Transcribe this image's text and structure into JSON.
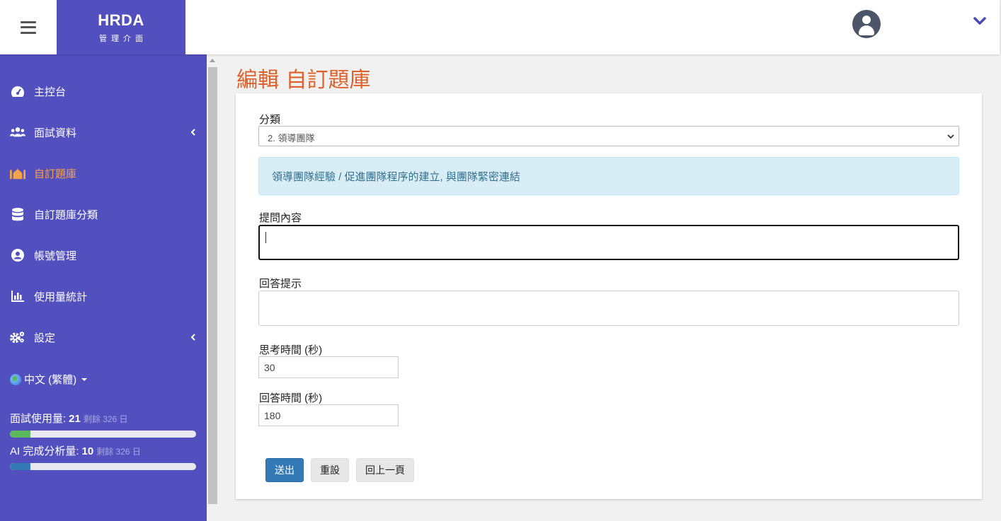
{
  "brand": {
    "name": "HRDA",
    "subtitle": "管理介面"
  },
  "page": {
    "title": "編輯 自訂題庫"
  },
  "sidebar": {
    "items": [
      {
        "label": "主控台",
        "icon": "tachometer-icon"
      },
      {
        "label": "面試資料",
        "icon": "users-icon"
      },
      {
        "label": "自訂題庫",
        "icon": "mosque-icon",
        "active": true
      },
      {
        "label": "自訂題庫分類",
        "icon": "database-icon"
      },
      {
        "label": "帳號管理",
        "icon": "user-circle-icon"
      },
      {
        "label": "使用量統計",
        "icon": "bar-chart-icon"
      },
      {
        "label": "設定",
        "icon": "gears-icon"
      }
    ],
    "language": "中文 (繁體)",
    "usage": {
      "interview": {
        "label": "面試使用量:",
        "count": "21",
        "remaining": "剩餘 326 日",
        "fill_fraction": 0.11,
        "color": "#5cb85c"
      },
      "ai": {
        "label": "AI 完成分析量:",
        "count": "10",
        "remaining": "剩餘 326 日",
        "fill_fraction": 0.11,
        "color": "#337ab7"
      }
    }
  },
  "form": {
    "category_label": "分類",
    "category_value": "2. 領導團隊",
    "category_info": "領導團隊經驗 / 促進團隊程序的建立, 與團隊緊密連結",
    "question_label": "提問內容",
    "question_value": "",
    "hint_label": "回答提示",
    "hint_value": "",
    "think_label": "思考時間 (秒)",
    "think_value": "30",
    "answer_label": "回答時間 (秒)",
    "answer_value": "180",
    "submit_label": "送出",
    "reset_label": "重設",
    "back_label": "回上一頁"
  },
  "colors": {
    "sidebar_bg": "#5150be",
    "active_item": "#f5a34a",
    "title": "#e0602a",
    "primary": "#337ab7"
  }
}
